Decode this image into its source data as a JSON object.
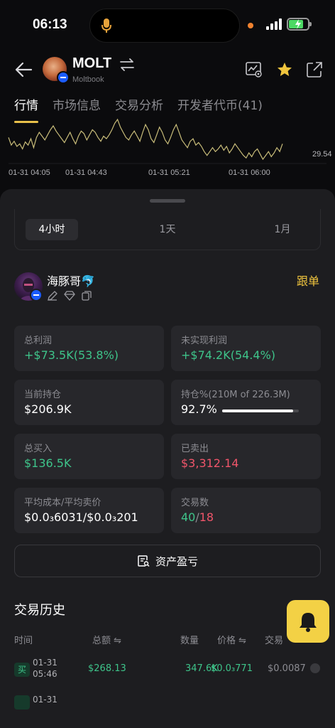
{
  "status_bar": {
    "time": "06:13"
  },
  "header": {
    "token_name": "MOLT",
    "token_sub": "Moltbook"
  },
  "tabs": [
    {
      "label": "行情"
    },
    {
      "label": "市场信息"
    },
    {
      "label": "交易分析"
    },
    {
      "label": "开发者代币(41)"
    }
  ],
  "chart_data": {
    "type": "line",
    "x_ticks": [
      "01-31 04:05",
      "01-31 04:43",
      "01-31 05:21",
      "01-31 06:00"
    ],
    "last_price_label": "29.54",
    "values": [
      62,
      50,
      56,
      48,
      52,
      44,
      55,
      50,
      60,
      46,
      62,
      70,
      64,
      58,
      66,
      74,
      80,
      72,
      66,
      60,
      54,
      62,
      70,
      60,
      52,
      64,
      72,
      68,
      58,
      66,
      74,
      70,
      62,
      56,
      64,
      60,
      66,
      74,
      84,
      90,
      78,
      70,
      62,
      58,
      66,
      72,
      64,
      56,
      70,
      82,
      74,
      60,
      54,
      66,
      78,
      70,
      58,
      52,
      62,
      74,
      82,
      70,
      58,
      52,
      46,
      56,
      60,
      50,
      54,
      48,
      40,
      34,
      40,
      46,
      40,
      44,
      50,
      42,
      48,
      38,
      44,
      52,
      46,
      40,
      34,
      30,
      38,
      32,
      40,
      44,
      36,
      28,
      34,
      40,
      32,
      38,
      46,
      40,
      52
    ]
  },
  "sheet": {
    "ranges": [
      {
        "label": "4小时",
        "active": true
      },
      {
        "label": "1天",
        "active": false
      },
      {
        "label": "1月",
        "active": false
      }
    ],
    "trader": {
      "name": "海豚哥🐬",
      "follow_label": "跟单"
    },
    "stats": {
      "total_profit": {
        "label": "总利润",
        "value": "+$73.5K(53.8%)"
      },
      "unrealized": {
        "label": "未实现利润",
        "value": "+$74.2K(54.4%)"
      },
      "holding": {
        "label": "当前持仓",
        "value": "$206.9K"
      },
      "holding_pct": {
        "label": "持仓%(210M of 226.3M)",
        "value": "92.7%",
        "fraction": 0.927
      },
      "total_buy": {
        "label": "总买入",
        "value": "$136.5K"
      },
      "sold": {
        "label": "已卖出",
        "value": "$3,312.14"
      },
      "avg_cost": {
        "label": "平均成本/平均卖价",
        "value": "$0.0₃6031/$0.0₃201"
      },
      "trades": {
        "label": "交易数",
        "buys": "40",
        "sep": "/",
        "sells": "18"
      }
    },
    "pnl_button": "资产盈亏",
    "history": {
      "title": "交易历史",
      "columns": {
        "time": "时间",
        "amount": "总额",
        "qty": "数量",
        "price": "价格",
        "trade": "交易"
      },
      "rows": [
        {
          "side": "买",
          "date": "01-31",
          "clock": "05:46",
          "amount": "$268.13",
          "qty": "347.6K",
          "price": "$0.0₃771",
          "trade_value": "$0.0087"
        }
      ],
      "partial_row_date": "01-31"
    }
  }
}
